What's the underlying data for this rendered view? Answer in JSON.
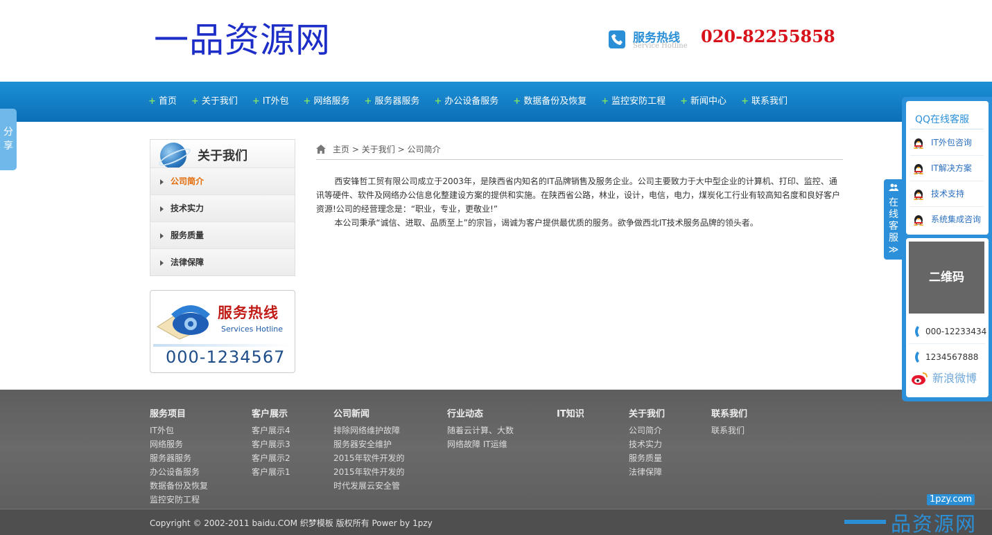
{
  "header": {
    "logo": "一品资源网",
    "hotline_title": "服务热线",
    "hotline_sub": "Service Hotline",
    "hotline_number": "020-82255858"
  },
  "nav": {
    "items": [
      "首页",
      "关于我们",
      "IT外包",
      "网络服务",
      "服务器服务",
      "办公设备服务",
      "数据备份及恢复",
      "监控安防工程",
      "新闻中心",
      "联系我们"
    ]
  },
  "share_tab": "分享",
  "sidebar": {
    "title": "关于我们",
    "items": [
      {
        "label": "公司简介",
        "active": true
      },
      {
        "label": "技术实力",
        "active": false
      },
      {
        "label": "服务质量",
        "active": false
      },
      {
        "label": "法律保障",
        "active": false
      }
    ],
    "hotline_title": "服务热线",
    "hotline_sub": "Services Hotline",
    "hotline_number": "000-1234567"
  },
  "breadcrumb": {
    "home": "主页",
    "separator": ">",
    "level1": "关于我们",
    "level2": "公司简介"
  },
  "article": {
    "p1": "西安锋哲工贸有限公司成立于2003年，是陕西省内知名的IT品牌销售及服务企业。公司主要致力于大中型企业的计算机、打印、监控、通讯等硬件、软件及网络办公信息化整建设方案的提供和实施。在陕西省公路，林业，设计，电信，电力，煤炭化工行业有较高知名度和良好客户资源!公司的经营理念是：“职业，专业，更敬业!”",
    "p2": "本公司秉承“诚信、进取、品质至上”的宗旨，谒诚为客户提供最优质的服务。欲争做西北IT技术服务品牌的领头者。"
  },
  "footer": {
    "columns": [
      {
        "title": "服务项目",
        "items": [
          "IT外包",
          "网络服务",
          "服务器服务",
          "办公设备服务",
          "数据备份及恢复",
          "监控安防工程"
        ]
      },
      {
        "title": "客户展示",
        "items": [
          "客户展示4",
          "客户展示3",
          "客户展示2",
          "客户展示1"
        ]
      },
      {
        "title": "公司新闻",
        "items": [
          "排除网络维护故障",
          "服务器安全维护",
          "2015年软件开发的",
          "2015年软件开发的",
          "时代发展云安全管"
        ]
      },
      {
        "title": "行业动态",
        "items": [
          "随着云计算、大数",
          "网络故障 IT运维"
        ]
      },
      {
        "title": "IT知识",
        "items": []
      },
      {
        "title": "关于我们",
        "items": [
          "公司简介",
          "技术实力",
          "服务质量",
          "法律保障"
        ]
      },
      {
        "title": "联系我们",
        "items": [
          "联系我们"
        ]
      }
    ],
    "copyright": "Copyright © 2002-2011 baidu.COM 织梦模板 版权所有 Power by 1pzy",
    "watermark_url": "1pzy.com",
    "watermark_text": "品资源网"
  },
  "online_tab": {
    "label_chars": [
      "在",
      "线",
      "客",
      "服"
    ],
    "arrow": "≫"
  },
  "qq_panel": {
    "title": "QQ在线客服",
    "items": [
      "IT外包咨询",
      "IT解决方案",
      "技术支持",
      "系统集成咨询"
    ],
    "qr_label": "二维码",
    "tel1": "000-12233434",
    "tel2": "1234567888",
    "weibo": "新浪微博"
  },
  "colors": {
    "brand_blue": "#2b90d9",
    "nav_blue": "#1c8fd5",
    "hotline_red": "#d8121a",
    "active_orange": "#e36c09",
    "footer_gray": "#5e5e5e"
  }
}
